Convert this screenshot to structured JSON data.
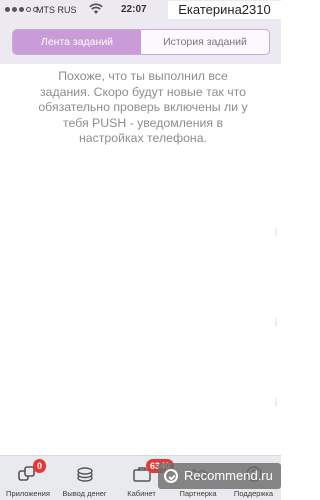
{
  "status_bar": {
    "carrier": "MTS RUS",
    "time": "22:07",
    "user_watermark": "Екатерина2310"
  },
  "tabs": {
    "items": [
      {
        "label": "Лента заданий",
        "active": true
      },
      {
        "label": "История заданий",
        "active": false
      }
    ]
  },
  "message": "Похоже, что ты выполнил все задания. Скоро будут новые так что обязательно проверь включены ли у тебя PUSH - уведомления в настройках телефона.",
  "tab_bar": {
    "items": [
      {
        "label": "Приложения",
        "icon": "apps-icon",
        "badge": "0"
      },
      {
        "label": "Вывод денег",
        "icon": "coins-icon"
      },
      {
        "label": "Кабинет",
        "icon": "cabinet-icon",
        "badge": "6340"
      },
      {
        "label": "Партнерка",
        "icon": "handshake-icon"
      },
      {
        "label": "Поддержка",
        "icon": "support-icon"
      }
    ]
  },
  "site_watermark": "Recommend.ru",
  "colors": {
    "accent": "#c99cd8",
    "badge": "#e53935",
    "message_text": "#8d8d8d"
  }
}
